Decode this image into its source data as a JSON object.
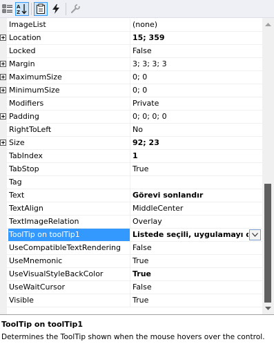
{
  "toolbar": {
    "buttons": [
      {
        "icon": "categorized-icon",
        "active": false
      },
      {
        "icon": "alphabetical-icon",
        "active": true
      },
      {
        "icon": "properties-icon",
        "active": true
      },
      {
        "icon": "events-icon",
        "active": false
      },
      {
        "icon": "property-pages-icon",
        "active": false
      }
    ]
  },
  "properties": [
    {
      "name": "ImageList",
      "value": "(none)",
      "bold": false,
      "expandable": false
    },
    {
      "name": "Location",
      "value": "15; 359",
      "bold": true,
      "expandable": true
    },
    {
      "name": "Locked",
      "value": "False",
      "bold": false,
      "expandable": false
    },
    {
      "name": "Margin",
      "value": "3; 3; 3; 3",
      "bold": false,
      "expandable": true
    },
    {
      "name": "MaximumSize",
      "value": "0; 0",
      "bold": false,
      "expandable": true
    },
    {
      "name": "MinimumSize",
      "value": "0; 0",
      "bold": false,
      "expandable": true
    },
    {
      "name": "Modifiers",
      "value": "Private",
      "bold": false,
      "expandable": false
    },
    {
      "name": "Padding",
      "value": "0; 0; 0; 0",
      "bold": false,
      "expandable": true
    },
    {
      "name": "RightToLeft",
      "value": "No",
      "bold": false,
      "expandable": false
    },
    {
      "name": "Size",
      "value": "92; 23",
      "bold": true,
      "expandable": true
    },
    {
      "name": "TabIndex",
      "value": "1",
      "bold": true,
      "expandable": false
    },
    {
      "name": "TabStop",
      "value": "True",
      "bold": false,
      "expandable": false
    },
    {
      "name": "Tag",
      "value": "",
      "bold": false,
      "expandable": false
    },
    {
      "name": "Text",
      "value": "Görevi sonlandır",
      "bold": true,
      "expandable": false
    },
    {
      "name": "TextAlign",
      "value": "MiddleCenter",
      "bold": false,
      "expandable": false
    },
    {
      "name": "TextImageRelation",
      "value": "Overlay",
      "bold": false,
      "expandable": false
    },
    {
      "name": "ToolTip on toolTip1",
      "value": "Listede seçili, uygulamayı direkt",
      "bold": true,
      "expandable": false,
      "selected": true
    },
    {
      "name": "UseCompatibleTextRendering",
      "value": "False",
      "bold": false,
      "expandable": false
    },
    {
      "name": "UseMnemonic",
      "value": "True",
      "bold": false,
      "expandable": false
    },
    {
      "name": "UseVisualStyleBackColor",
      "value": "True",
      "bold": true,
      "expandable": false
    },
    {
      "name": "UseWaitCursor",
      "value": "False",
      "bold": false,
      "expandable": false
    },
    {
      "name": "Visible",
      "value": "True",
      "bold": false,
      "expandable": false
    }
  ],
  "description": {
    "title": "ToolTip on toolTip1",
    "text": "Determines the ToolTip shown when the mouse hovers over the control."
  },
  "colors": {
    "selection": "#3399ff",
    "toolbar_bg": "#eef0f6",
    "scroll_thumb": "#606060"
  }
}
